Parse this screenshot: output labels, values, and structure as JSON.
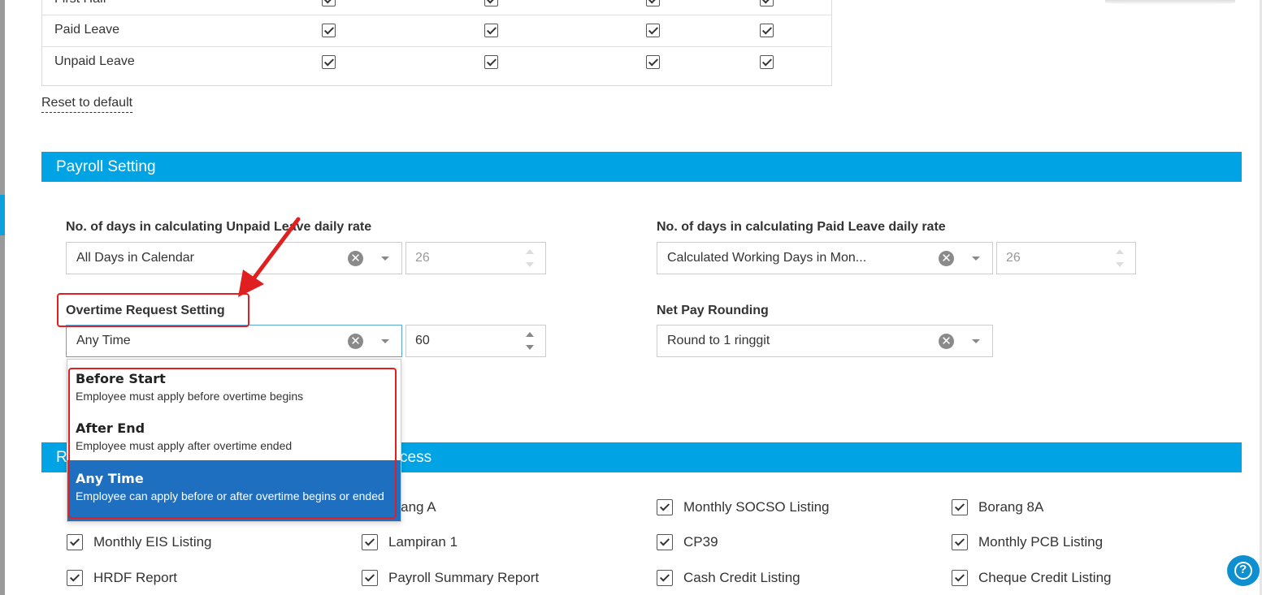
{
  "leave_table": {
    "rows": [
      {
        "label": "First Half"
      },
      {
        "label": "Paid Leave"
      },
      {
        "label": "Unpaid Leave"
      }
    ],
    "reset_label": "Reset to default"
  },
  "payroll": {
    "section_title": "Payroll Setting",
    "unpaid_label": "No. of days in calculating Unpaid Leave daily rate",
    "unpaid_value": "All Days in Calendar",
    "unpaid_days": "26",
    "paid_label": "No. of days in calculating Paid Leave daily rate",
    "paid_value": "Calculated Working Days in Mon...",
    "paid_days": "26",
    "overtime_label": "Overtime Request Setting",
    "overtime_value": "Any Time",
    "overtime_minutes": "60",
    "rounding_label": "Net Pay Rounding",
    "rounding_value": "Round to 1 ringgit"
  },
  "overtime_options": [
    {
      "title": "Before Start",
      "desc": "Employee must apply before overtime begins"
    },
    {
      "title": "After End",
      "desc": "Employee must apply after overtime ended"
    },
    {
      "title": "Any Time",
      "desc": "Employee can apply before or after overtime begins or ended"
    }
  ],
  "reports": {
    "section_title_left": "R",
    "section_title_right": "cess",
    "items": [
      {
        "label": "orang A"
      },
      {
        "label": "Monthly SOCSO Listing"
      },
      {
        "label": "Borang 8A"
      },
      {
        "label": "Monthly EIS Listing"
      },
      {
        "label": "Lampiran 1"
      },
      {
        "label": "CP39"
      },
      {
        "label": "Monthly PCB Listing"
      },
      {
        "label": "HRDF Report"
      },
      {
        "label": "Payroll Summary Report"
      },
      {
        "label": "Cash Credit Listing"
      },
      {
        "label": "Cheque Credit Listing"
      }
    ]
  },
  "colors": {
    "accent": "#00a3e3",
    "selected": "#1f6fc0",
    "highlight": "#e02020"
  },
  "icons": {
    "clear": "circle-x-icon",
    "help": "question-circle-icon"
  }
}
